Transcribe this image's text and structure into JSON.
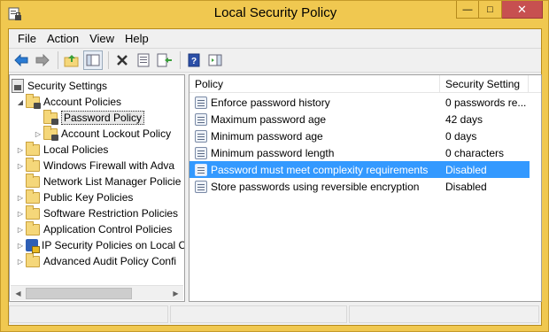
{
  "window": {
    "title": "Local Security Policy"
  },
  "caption": {
    "minimize": "—",
    "maximize": "□",
    "close": "✕"
  },
  "menu": [
    {
      "label": "File"
    },
    {
      "label": "Action"
    },
    {
      "label": "View"
    },
    {
      "label": "Help"
    }
  ],
  "toolbar": {
    "icons": [
      "back-arrow-icon",
      "forward-arrow-icon",
      "up-folder-icon",
      "show-hide-tree-icon",
      "delete-icon",
      "properties-icon",
      "export-list-icon",
      "help-icon",
      "show-action-pane-icon"
    ]
  },
  "tree": {
    "root": "Security Settings",
    "items": [
      {
        "label": "Account Policies"
      },
      {
        "label": "Password Policy"
      },
      {
        "label": "Account Lockout Policy"
      },
      {
        "label": "Local Policies"
      },
      {
        "label": "Windows Firewall with Adva"
      },
      {
        "label": "Network List Manager Policie"
      },
      {
        "label": "Public Key Policies"
      },
      {
        "label": "Software Restriction Policies"
      },
      {
        "label": "Application Control Policies"
      },
      {
        "label": "IP Security Policies on Local C"
      },
      {
        "label": "Advanced Audit Policy Confi"
      }
    ]
  },
  "list": {
    "columns": [
      "Policy",
      "Security Setting"
    ],
    "rows": [
      {
        "policy": "Enforce password history",
        "setting": "0 passwords re..."
      },
      {
        "policy": "Maximum password age",
        "setting": "42 days"
      },
      {
        "policy": "Minimum password age",
        "setting": "0 days"
      },
      {
        "policy": "Minimum password length",
        "setting": "0 characters"
      },
      {
        "policy": "Password must meet complexity requirements",
        "setting": "Disabled"
      },
      {
        "policy": "Store passwords using reversible encryption",
        "setting": "Disabled"
      }
    ],
    "selected_index": 4
  },
  "colors": {
    "titlebar": "#f0c850",
    "selection": "#3399ff",
    "close_button": "#c75050"
  }
}
